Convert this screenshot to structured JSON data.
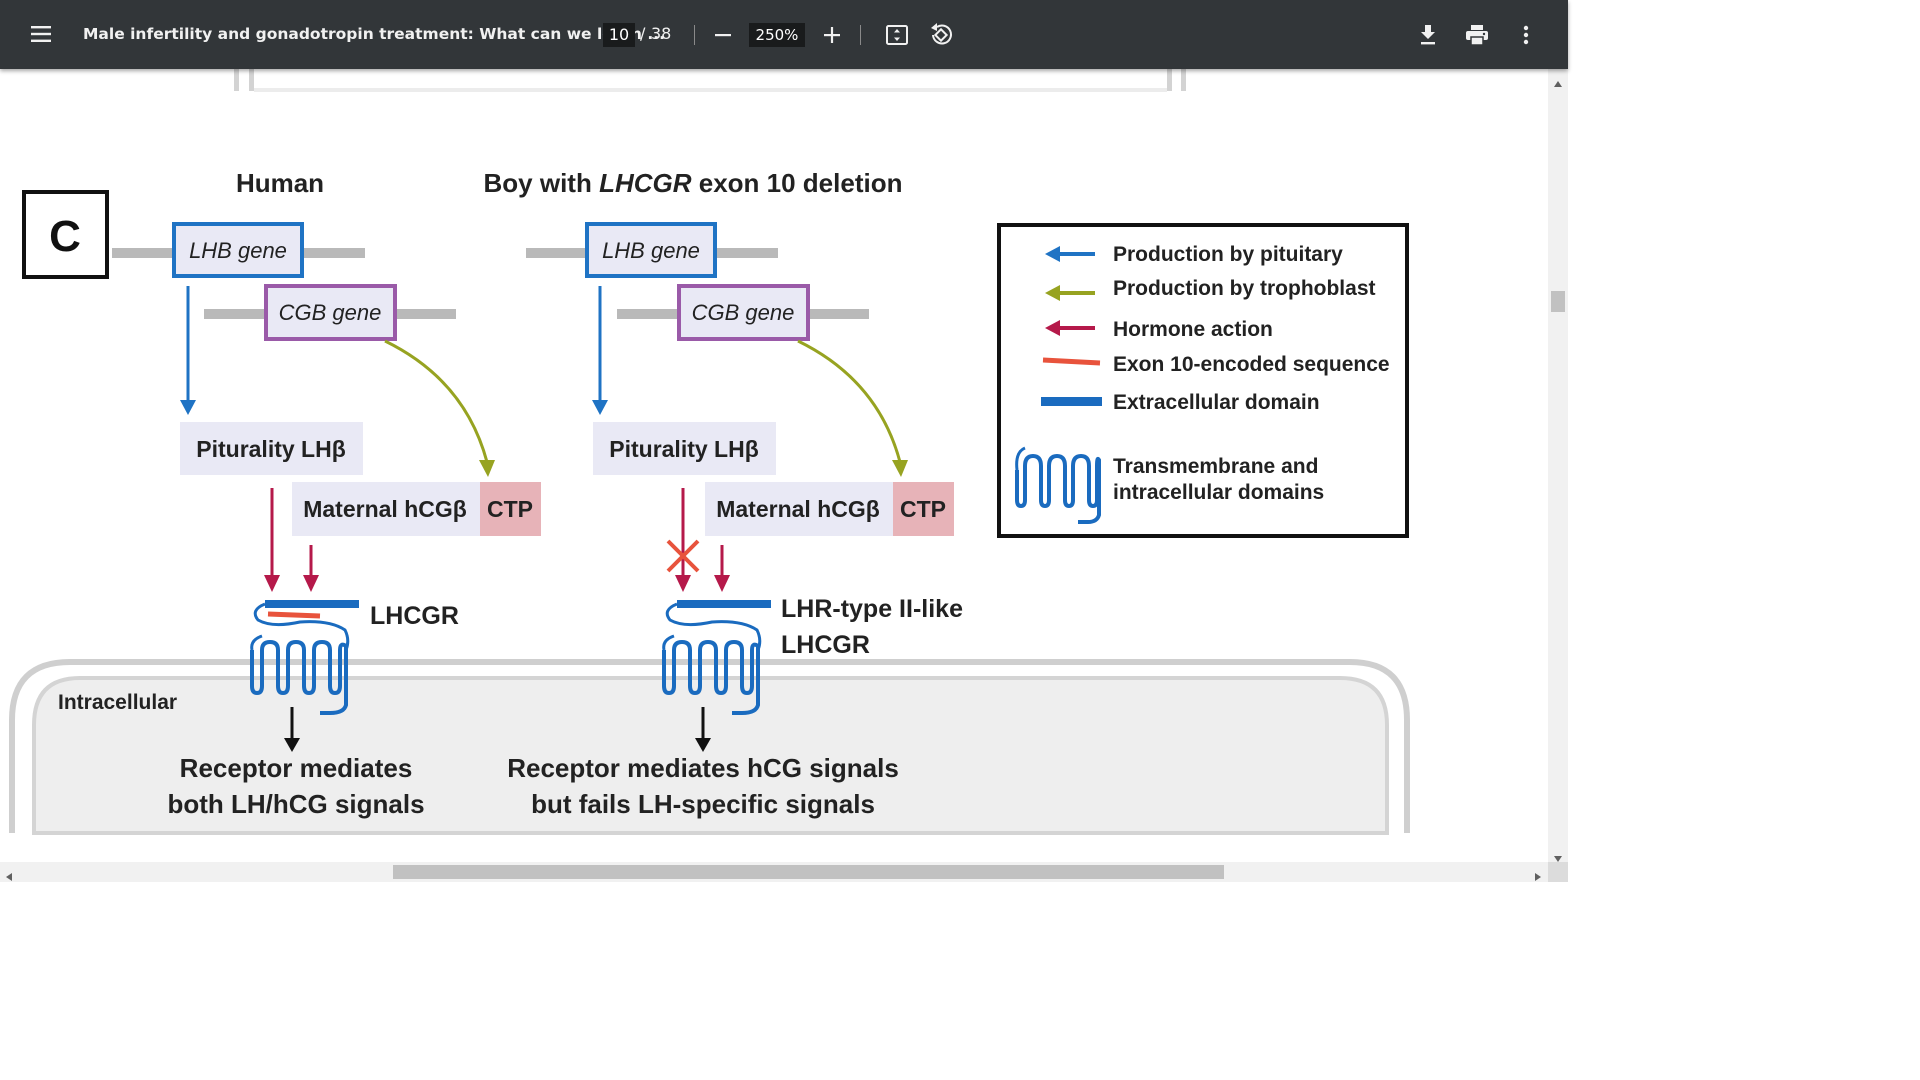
{
  "toolbar": {
    "title": "Male infertility and gonadotropin treatment: What can we learn ...",
    "current_page": "10",
    "page_separator": "/",
    "total_pages": "38",
    "zoom": "250%",
    "icons": [
      "menu-icon",
      "zoom-out-icon",
      "zoom-in-icon",
      "fit-page-icon",
      "rotate-icon",
      "download-icon",
      "print-icon",
      "more-vert-icon"
    ]
  },
  "figure": {
    "panel_label": "C",
    "human": {
      "header": "Human",
      "lhb_gene": "LHB gene",
      "cgb_gene": "CGB gene",
      "pituitary": "Piturality LHβ",
      "maternal": "Maternal hCGβ",
      "ctp": "CTP",
      "receptor": "LHCGR",
      "outcome_line1": "Receptor mediates",
      "outcome_line2": "both LH/hCG signals"
    },
    "boy": {
      "header_pre": "Boy with ",
      "header_gene": "LHCGR",
      "header_post": " exon 10 deletion",
      "lhb_gene": "LHB gene",
      "cgb_gene": "CGB gene",
      "pituitary": "Piturality LHβ",
      "maternal": "Maternal hCGβ",
      "ctp": "CTP",
      "receptor_line1": "LHR-type II-like",
      "receptor_line2": "LHCGR",
      "outcome_line1": "Receptor mediates hCG signals",
      "outcome_line2": "but fails LH-specific signals"
    },
    "intracellular": "Intracellular",
    "legend": {
      "items": [
        {
          "label": "Production by pituitary",
          "color": "#1f73c4"
        },
        {
          "label": "Production by trophoblast",
          "color": "#97a321"
        },
        {
          "label": "Hormone action",
          "color": "#b5194a"
        },
        {
          "label": "Exon 10-encoded sequence",
          "color": "#e8533c"
        },
        {
          "label": "Extracellular domain",
          "color": "#1a6bbf"
        }
      ],
      "tm_line1": "Transmembrane and",
      "tm_line2": "intracellular domains"
    }
  },
  "colors": {
    "toolbar_bg": "#323639",
    "lhb_border": "#1f73c4",
    "cgb_border": "#9a5aa8",
    "box_fill": "#e9e9f5",
    "ctp_fill": "#e7b3b8",
    "blue_arrow": "#1f73c4",
    "olive_arrow": "#97a321",
    "red_arrow": "#b5194a",
    "exon_red": "#e8533c",
    "receptor_blue": "#1a6bbf"
  }
}
